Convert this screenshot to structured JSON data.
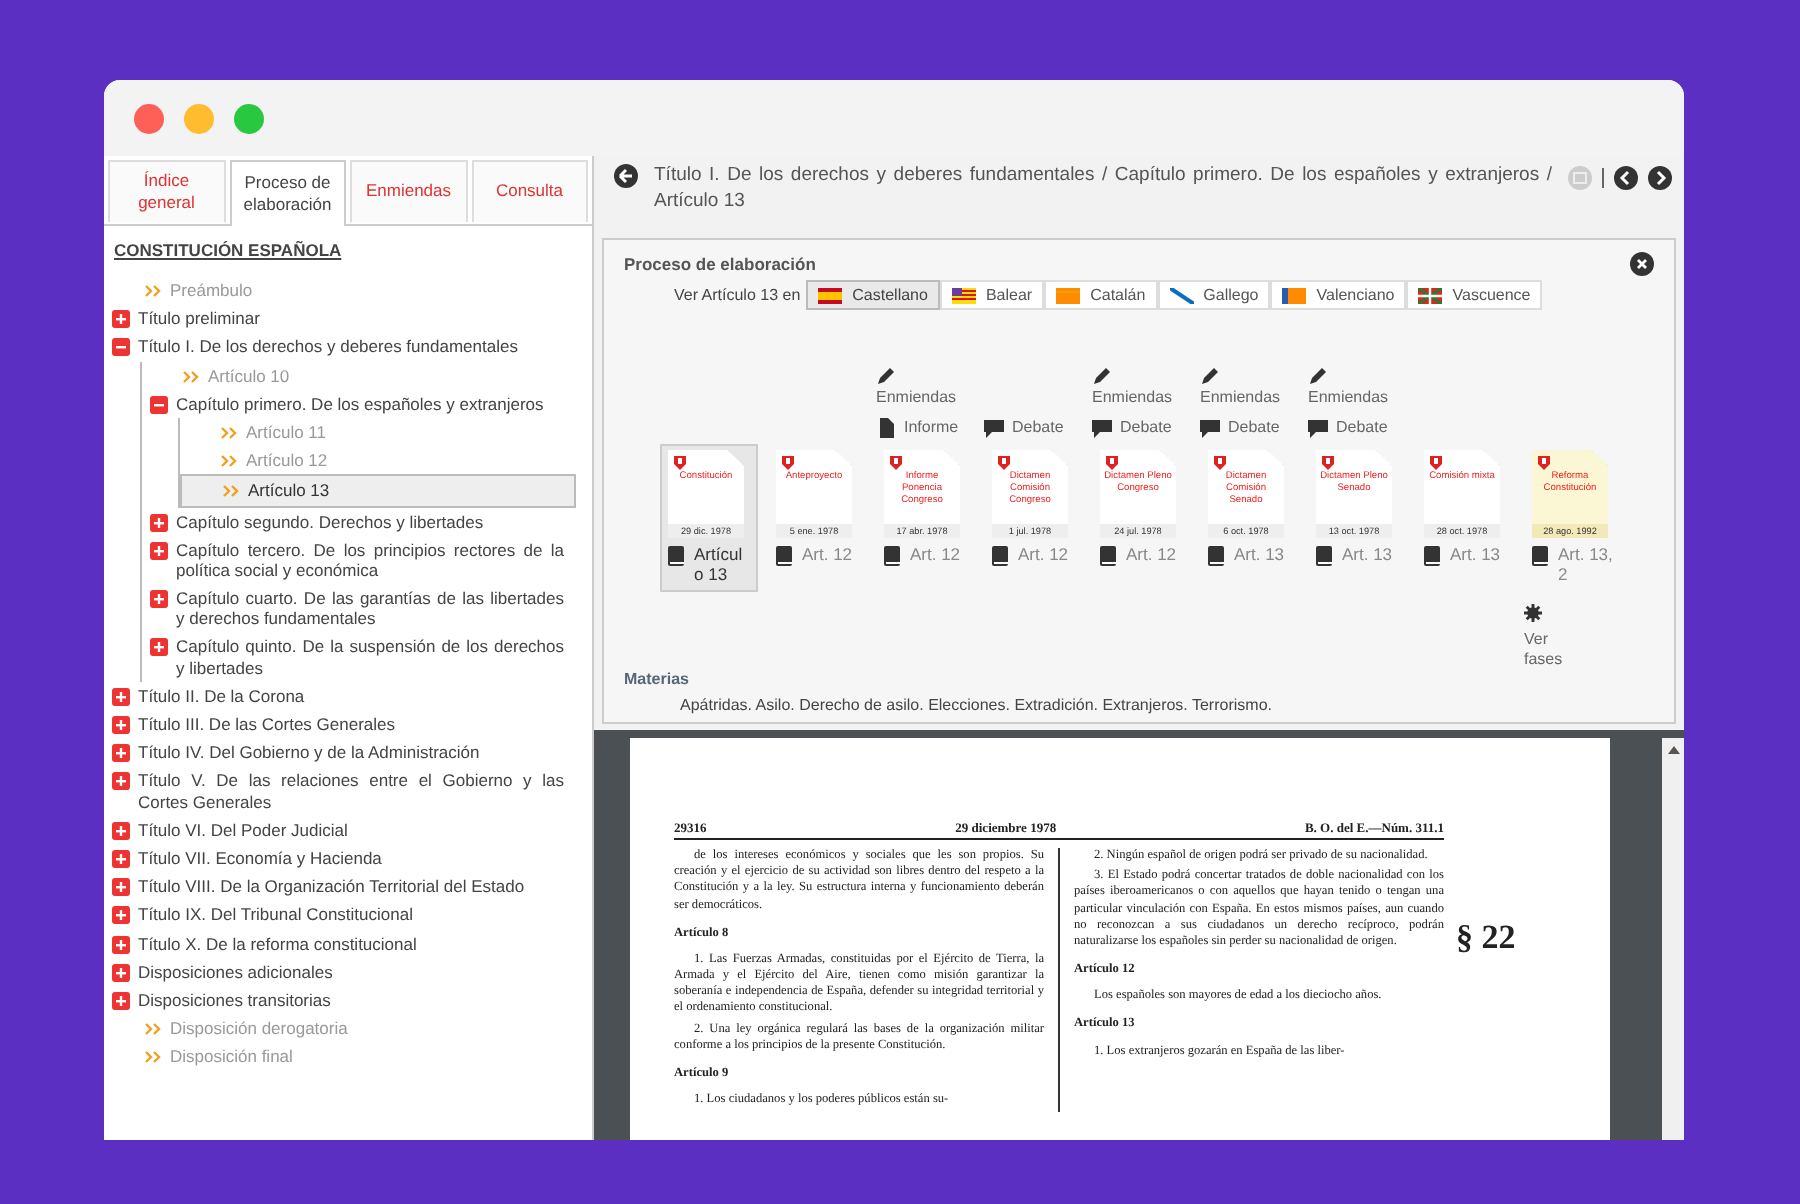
{
  "tabs": [
    {
      "label": "Índice general",
      "selected": false
    },
    {
      "label": "Proceso de elaboración",
      "selected": true
    },
    {
      "label": "Enmiendas",
      "selected": false
    },
    {
      "label": "Consulta",
      "selected": false
    }
  ],
  "tree_title": "CONSTITUCIÓN ESPAÑOLA",
  "tree": [
    {
      "kind": "leaf",
      "label": "Preámbulo",
      "selected": false
    },
    {
      "kind": "node",
      "label": "Título preliminar",
      "expanded": false,
      "selected": false
    },
    {
      "kind": "node",
      "label": "Título I. De los derechos y deberes fundamentales",
      "expanded": true,
      "selected": false,
      "children": [
        {
          "kind": "leaf",
          "label": "Artículo 10",
          "selected": false
        },
        {
          "kind": "node",
          "label": "Capítulo primero. De los españoles y extranjeros",
          "expanded": true,
          "selected": false,
          "children": [
            {
              "kind": "leaf",
              "label": "Artículo 11",
              "selected": false
            },
            {
              "kind": "leaf",
              "label": "Artículo 12",
              "selected": false
            },
            {
              "kind": "leaf",
              "label": "Artículo 13",
              "selected": true
            }
          ]
        },
        {
          "kind": "node",
          "label": "Capítulo segundo. Derechos y libertades",
          "expanded": false,
          "selected": false
        },
        {
          "kind": "node",
          "label": "Capítulo tercero. De los principios rectores de la política social y económica",
          "expanded": false,
          "selected": false
        },
        {
          "kind": "node",
          "label": "Capítulo cuarto. De las garantías de las libertades y derechos fundamentales",
          "expanded": false,
          "selected": false
        },
        {
          "kind": "node",
          "label": "Capítulo quinto. De la suspensión de los derechos y libertades",
          "expanded": false,
          "selected": false
        }
      ]
    },
    {
      "kind": "node",
      "label": "Título II. De la Corona",
      "expanded": false,
      "selected": false
    },
    {
      "kind": "node",
      "label": "Título III. De las Cortes Generales",
      "expanded": false,
      "selected": false
    },
    {
      "kind": "node",
      "label": "Título IV. Del Gobierno y de la Administración",
      "expanded": false,
      "selected": false
    },
    {
      "kind": "node",
      "label": "Título V. De las relaciones entre el Gobierno y las Cortes Generales",
      "expanded": false,
      "selected": false
    },
    {
      "kind": "node",
      "label": "Título VI. Del Poder Judicial",
      "expanded": false,
      "selected": false
    },
    {
      "kind": "node",
      "label": "Título VII. Economía y Hacienda",
      "expanded": false,
      "selected": false
    },
    {
      "kind": "node",
      "label": "Título VIII. De la Organización Territorial del Estado",
      "expanded": false,
      "selected": false
    },
    {
      "kind": "node",
      "label": "Título IX. Del Tribunal Constitucional",
      "expanded": false,
      "selected": false
    },
    {
      "kind": "node",
      "label": "Título X. De la reforma constitucional",
      "expanded": false,
      "selected": false
    },
    {
      "kind": "node",
      "label": "Disposiciones adicionales",
      "expanded": false,
      "selected": false
    },
    {
      "kind": "node",
      "label": "Disposiciones transitorias",
      "expanded": false,
      "selected": false
    },
    {
      "kind": "leaf",
      "label": "Disposición derogatoria",
      "selected": false
    },
    {
      "kind": "leaf",
      "label": "Disposición final",
      "selected": false
    }
  ],
  "breadcrumb": "Título I. De los derechos y deberes fundamentales / Capítulo primero. De los españoles y extranjeros / Artículo 13",
  "panel": {
    "title": "Proceso de elaboración",
    "languages_label": "Ver Artículo 13 en",
    "languages": [
      {
        "kind": "es",
        "label": "Castellano",
        "selected": true
      },
      {
        "kind": "ib",
        "label": "Balear",
        "selected": false
      },
      {
        "kind": "ca",
        "label": "Catalán",
        "selected": false
      },
      {
        "kind": "gl",
        "label": "Gallego",
        "selected": false
      },
      {
        "kind": "va",
        "label": "Valenciano",
        "selected": false
      },
      {
        "kind": "eu",
        "label": "Vascuence",
        "selected": false
      }
    ],
    "stages": [
      {
        "title": "Constitución",
        "date": "29 dic. 1978",
        "article": "Artículo 13",
        "selected": true,
        "highlighted": false
      },
      {
        "title": "Anteproyecto",
        "date": "5 ene. 1978",
        "article": "Art. 12",
        "selected": false,
        "highlighted": false
      },
      {
        "title": "Informe Ponencia Congreso",
        "date": "17 abr. 1978",
        "article": "Art. 12",
        "selected": false,
        "highlighted": false,
        "actions": [
          {
            "kind": "amend",
            "label": "Enmiendas"
          },
          {
            "kind": "report",
            "label": "Informe"
          }
        ]
      },
      {
        "title": "Dictamen Comisión Congreso",
        "date": "1 jul. 1978",
        "article": "Art. 12",
        "selected": false,
        "highlighted": false,
        "actions": [
          {
            "kind": "debate",
            "label": "Debate"
          }
        ]
      },
      {
        "title": "Dictamen Pleno Congreso",
        "date": "24 jul. 1978",
        "article": "Art. 12",
        "selected": false,
        "highlighted": false,
        "actions": [
          {
            "kind": "amend",
            "label": "Enmiendas"
          },
          {
            "kind": "debate",
            "label": "Debate"
          }
        ]
      },
      {
        "title": "Dictamen Comisión Senado",
        "date": "6 oct. 1978",
        "article": "Art. 13",
        "selected": false,
        "highlighted": false,
        "actions": [
          {
            "kind": "amend",
            "label": "Enmiendas"
          },
          {
            "kind": "debate",
            "label": "Debate"
          }
        ]
      },
      {
        "title": "Dictamen Pleno Senado",
        "date": "13 oct. 1978",
        "article": "Art. 13",
        "selected": false,
        "highlighted": false,
        "actions": [
          {
            "kind": "amend",
            "label": "Enmiendas"
          },
          {
            "kind": "debate",
            "label": "Debate"
          }
        ]
      },
      {
        "title": "Comisión mixta",
        "date": "28 oct. 1978",
        "article": "Art. 13",
        "selected": false,
        "highlighted": false
      },
      {
        "title": "Reforma Constitución",
        "date": "28 ago. 1992",
        "article": "Art. 13, 2",
        "selected": false,
        "highlighted": true,
        "phases_link": "Ver fases"
      }
    ],
    "subjects_title": "Materias",
    "subjects": "Apátridas. Asilo. Derecho de asilo. Elecciones. Extradición. Extranjeros. Terrorismo."
  },
  "document": {
    "page_number": "29316",
    "date": "29 diciembre 1978",
    "gazette": "B. O. del E.—Núm. 311.1",
    "section": "§ 22",
    "left_column": [
      {
        "kind": "para",
        "text": "de los intereses económicos y sociales que les son propios. Su creación y el ejercicio de su actividad son libres dentro del respeto a la Constitución y a la ley. Su estructura interna y funcionamiento deberán ser democráticos."
      },
      {
        "kind": "heading",
        "text": "Artículo 8"
      },
      {
        "kind": "para",
        "text": "1. Las Fuerzas Armadas, constituidas por el Ejército de Tierra, la Armada y el Ejército del Aire, tienen como misión garantizar la soberanía e independencia de España, defender su integridad territorial y el ordenamiento constitucional."
      },
      {
        "kind": "para",
        "text": "2. Una ley orgánica regulará las bases de la organización militar conforme a los principios de la presente Constitución."
      },
      {
        "kind": "heading",
        "text": "Artículo 9"
      },
      {
        "kind": "para",
        "text": "1. Los ciudadanos y los poderes públicos están su-"
      }
    ],
    "right_column": [
      {
        "kind": "para",
        "text": "2. Ningún español de origen podrá ser privado de su nacionalidad."
      },
      {
        "kind": "para",
        "text": "3. El Estado podrá concertar tratados de doble nacionalidad con los países iberoamericanos o con aquellos que hayan tenido o tengan una particular vinculación con España. En estos mismos países, aun cuando no reconozcan a sus ciudadanos un derecho recíproco, podrán naturalizarse los españoles sin perder su nacionalidad de origen."
      },
      {
        "kind": "heading",
        "text": "Artículo 12"
      },
      {
        "kind": "para",
        "text": "Los españoles son mayores de edad a los dieciocho años."
      },
      {
        "kind": "heading",
        "text": "Artículo 13"
      },
      {
        "kind": "para",
        "text": "1. Los extranjeros gozarán en España de las liber-"
      }
    ]
  }
}
